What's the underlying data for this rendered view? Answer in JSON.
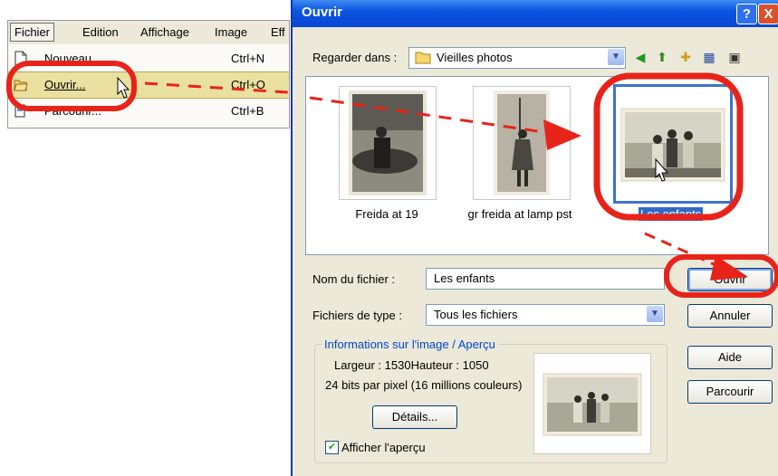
{
  "menu": {
    "items": [
      "Fichier",
      "Edition",
      "Affichage",
      "Image",
      "Eff"
    ],
    "entries": [
      {
        "label": "Nouveau",
        "shortcut": "Ctrl+N"
      },
      {
        "label": "Ouvrir...",
        "shortcut": "Ctrl+O"
      },
      {
        "label": "Parcourir...",
        "shortcut": "Ctrl+B"
      }
    ]
  },
  "dialog": {
    "title": "Ouvrir",
    "help_button": "?",
    "close_button": "X",
    "look_in_label": "Regarder dans :",
    "look_in_value": "Vieilles photos",
    "files": [
      {
        "name": "Freida at 19",
        "selected": false
      },
      {
        "name": "gr freida at lamp pst",
        "selected": false
      },
      {
        "name": "Les enfants",
        "selected": true
      }
    ],
    "filename_label": "Nom du fichier :",
    "filename_value": "Les enfants",
    "filetype_label": "Fichiers de type :",
    "filetype_value": "Tous les fichiers",
    "buttons": {
      "open": "Ouvrir",
      "cancel": "Annuler",
      "help": "Aide",
      "browse": "Parcourir"
    },
    "info": {
      "title": "Informations sur l'image / Aperçu",
      "dimensions": "Largeur : 1530Hauteur : 1050",
      "depth": "24 bits par pixel (16 millions couleurs)",
      "details_button": "Détails...",
      "show_preview_label": "Afficher l'aperçu",
      "show_preview_checked": true
    }
  },
  "colors": {
    "annotation": "#e8231a",
    "selection": "#316ac5",
    "titlebar": "#0a55e0"
  }
}
